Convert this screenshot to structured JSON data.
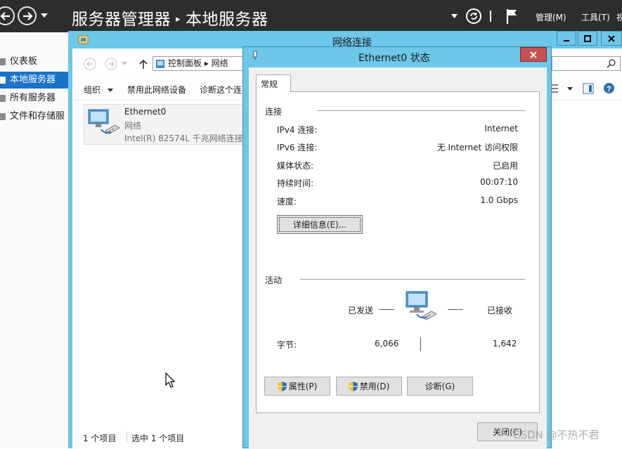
{
  "server_manager": {
    "breadcrumb_root": "服务器管理器",
    "breadcrumb_current": "本地服务器",
    "menu_manage": "管理(M)",
    "menu_tools": "工具(T)",
    "menu_view": "视",
    "nav": [
      "仪表板",
      "本地服务器",
      "所有服务器",
      "文件和存储服"
    ]
  },
  "net_window": {
    "title": "网络连接",
    "address": "控制面板 ▸ 网络",
    "commands": [
      "组织",
      "禁用此网络设备",
      "诊断这个连"
    ],
    "item": {
      "name": "Ethernet0",
      "type": "网络",
      "adapter": "Intel(R) 82574L 千兆网络连接"
    },
    "status_count": "1 个项目",
    "status_selected": "选中 1 个项目"
  },
  "dialog": {
    "title": "Ethernet0 状态",
    "tab": "常规",
    "connection_group": "连接",
    "rows": [
      {
        "label": "IPv4 连接:",
        "value": "Internet"
      },
      {
        "label": "IPv6 连接:",
        "value": "无 Internet 访问权限"
      },
      {
        "label": "媒体状态:",
        "value": "已启用"
      },
      {
        "label": "持续时间:",
        "value": "00:07:10"
      },
      {
        "label": "速度:",
        "value": "1.0 Gbps"
      }
    ],
    "details_button": "详细信息(E)...",
    "activity_group": "活动",
    "sent_label": "已发送",
    "received_label": "已接收",
    "bytes_label": "字节:",
    "bytes_sent": "6,066",
    "bytes_received": "1,642",
    "properties_button": "属性(P)",
    "disable_button": "禁用(D)",
    "diagnose_button": "诊断(G)",
    "close_button": "关闭(C)"
  },
  "watermark": "CSDN @不热不君",
  "colors": {
    "titlebar": "#6cc7e9",
    "header": "#2d2d30",
    "nav_active": "#1a73c7",
    "close": "#c75050"
  }
}
